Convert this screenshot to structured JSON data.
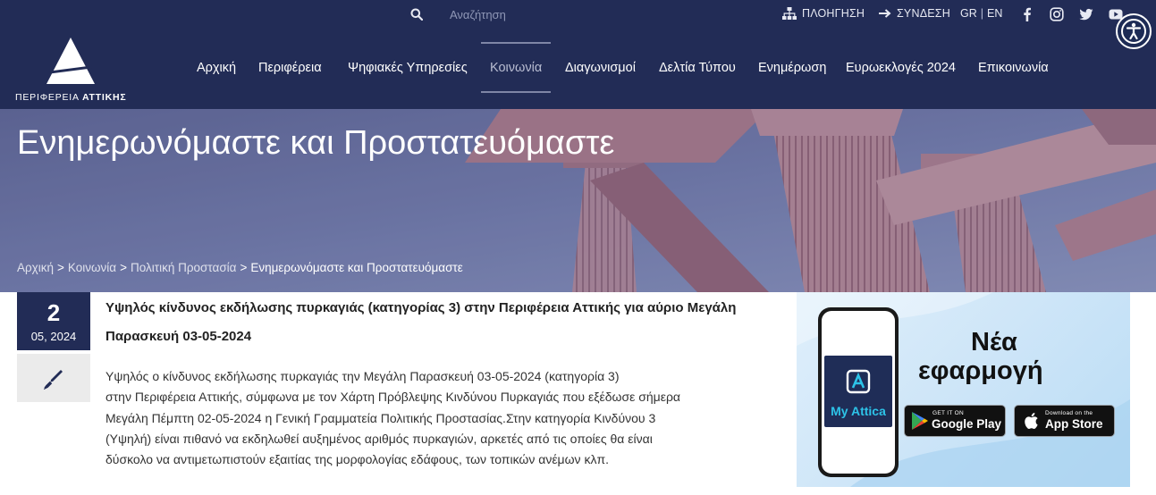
{
  "topbar": {
    "search_placeholder": "Αναζήτηση",
    "sitemap_label": "ΠΛΟΗΓΗΣΗ",
    "login_label": "ΣΥΝΔΕΣΗ",
    "lang_gr": "GR",
    "lang_sep": "|",
    "lang_en": "EN",
    "social_icons": [
      "facebook-icon",
      "instagram-icon",
      "twitter-icon",
      "youtube-icon"
    ]
  },
  "logo": {
    "text_prefix": "ΠΕΡΙΦΕΡΕΙΑ ",
    "text_bold": "ΑΤΤΙΚΗΣ"
  },
  "nav": {
    "items": [
      {
        "label": "Αρχική"
      },
      {
        "label": "Περιφέρεια"
      },
      {
        "label": "Ψηφιακές Υπηρεσίες"
      },
      {
        "label": "Κοινωνία",
        "active": true
      },
      {
        "label": "Διαγωνισμοί"
      },
      {
        "label": "Δελτία Τύπου"
      },
      {
        "label": "Ενημέρωση"
      },
      {
        "label": "Ευρωεκλογές 2024"
      },
      {
        "label": "Επικοινωνία"
      }
    ]
  },
  "hero": {
    "title": "Ενημερωνόμαστε και Προστατευόμαστε"
  },
  "breadcrumb": {
    "items": [
      "Αρχική",
      "Κοινωνία",
      "Πολιτική Προστασία"
    ],
    "separator": ">",
    "current": "Ενημερωνόμαστε και Προστατευόμαστε"
  },
  "article": {
    "day": "2",
    "month_year": "05, 2024",
    "title": "Υψηλός κίνδυνος εκδήλωσης πυρκαγιάς (κατηγορίας 3) στην Περιφέρεια Αττικής για αύριο Μεγάλη Παρασκευή 03-05-2024",
    "body_lines": [
      "Υψηλός ο κίνδυνος εκδήλωσης πυρκαγιάς την Μεγάλη Παρασκευή 03-05-2024 (κατηγορία 3)",
      "στην Περιφέρεια Αττικής,  σύμφωνα με τον Χάρτη Πρόβλεψης Κινδύνου Πυρκαγιάς που εξέδωσε σήμερα",
      "Μεγάλη Πέμπτη 02-05-2024 η Γενική Γραμματεία Πολιτικής Προστασίας.Στην κατηγορία Κινδύνου 3",
      "(Υψηλή) είναι πιθανό να εκδηλωθεί αυξημένος αριθμός πυρκαγιών, αρκετές από τις οποίες θα είναι",
      "δύσκολο να αντιμετωπιστούν εξαιτίας της μορφολογίας εδάφους, των τοπικών ανέμων κλπ."
    ]
  },
  "ad": {
    "app_name": "My Attica",
    "headline_1": "Νέα",
    "headline_2": "εφαρμογή",
    "google_small": "GET IT ON",
    "google_big": "Google Play",
    "apple_small": "Download on the",
    "apple_big": "App Store"
  },
  "colors": {
    "navy": "#222c56",
    "ad_accent": "#2dc3e8"
  }
}
